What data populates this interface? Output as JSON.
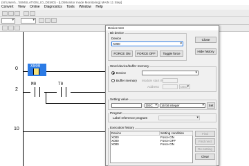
{
  "app": {
    "title": "(N:\\Users\\...\\SIMULATION_IO_DEMO) - [LD\\Monitor mode Monitoring]  MAIN   11 Step]",
    "menu": [
      "Convert",
      "View",
      "Online",
      "Diagnostics",
      "Tools",
      "Window",
      "Help"
    ]
  },
  "ladder": {
    "rungs": [
      "0",
      "2",
      "10"
    ],
    "contacts": [
      {
        "device": "X000",
        "energized": true
      },
      {
        "device": "M0",
        "energized": false
      },
      {
        "device": "T0",
        "energized": false
      }
    ]
  },
  "dialog": {
    "title": "Device test",
    "bit_device": {
      "group_label": "Bit device",
      "device_label": "Device",
      "device_value": "X000",
      "force_on": "FORCE ON",
      "force_off": "FORCE OFF",
      "toggle_force": "Toggle force"
    },
    "close_label": "Close",
    "hide_history_label": "Hide history",
    "word": {
      "group_label": "Word device/buffer memory",
      "device_option": "Device",
      "buffer_option": "Buffer memory",
      "module_start_label": "Module start I/O",
      "address_label": "Address",
      "address_format": "DEC"
    },
    "setting": {
      "group_label": "Setting value",
      "format": "DEC",
      "type": "16 bit integer",
      "set_label": "Set"
    },
    "program": {
      "group_label": "Program",
      "label_ref": "Label reference program"
    },
    "history": {
      "group_label": "Execution history",
      "columns": [
        "Device",
        "Setting condition"
      ],
      "rows": [
        {
          "device": "X000",
          "condition": "Force ON"
        },
        {
          "device": "X000",
          "condition": "Force OFF"
        },
        {
          "device": "X000",
          "condition": "Force ON"
        }
      ],
      "find_label": "Find",
      "find_next_label": "Find next",
      "re_setting_label": "Re-setting",
      "clear_label": "Clear"
    }
  }
}
